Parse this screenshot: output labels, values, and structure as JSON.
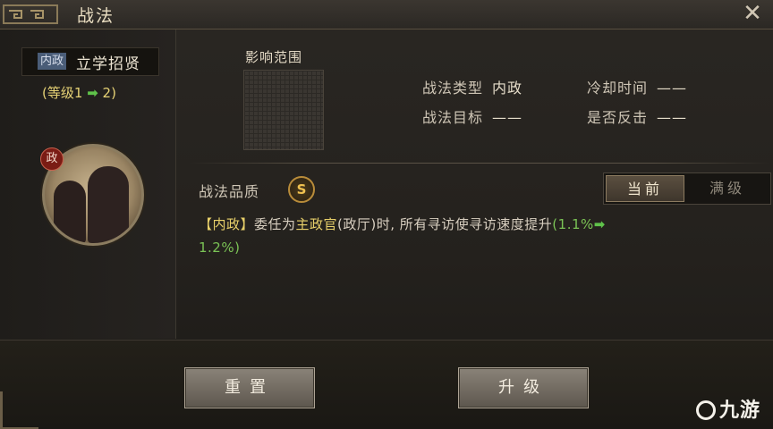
{
  "window": {
    "title": "战法"
  },
  "left": {
    "tag": "内政",
    "skill_name": "立学招贤",
    "level_prefix": "(等级1",
    "level_arrow": "➡",
    "level_suffix": "2)",
    "portrait_badge": "政"
  },
  "info": {
    "influence_label": "影响范围",
    "type_label": "战法类型",
    "type_value": "内政",
    "cooldown_label": "冷却时间",
    "cooldown_value": "——",
    "target_label": "战法目标",
    "target_value": "——",
    "counter_label": "是否反击",
    "counter_value": "——"
  },
  "quality": {
    "label": "战法品质",
    "grade": "S"
  },
  "toggle": {
    "current": "当前",
    "max": "满级",
    "selected": "current"
  },
  "description": {
    "tag": "【内政】",
    "part1": "委任为",
    "role": "主政官",
    "part2": "(政厅)时, 所有寻访使寻访速度提升",
    "value_from": "(1.1%",
    "arrow": "➡",
    "value_to": "1.2%)"
  },
  "buttons": {
    "reset": "重置",
    "upgrade": "升级"
  },
  "watermark": {
    "text": "九游"
  },
  "colors": {
    "accent_gold": "#e8d06a",
    "arrow_green": "#5fc24a",
    "tag_blue": "#4a5d78"
  }
}
